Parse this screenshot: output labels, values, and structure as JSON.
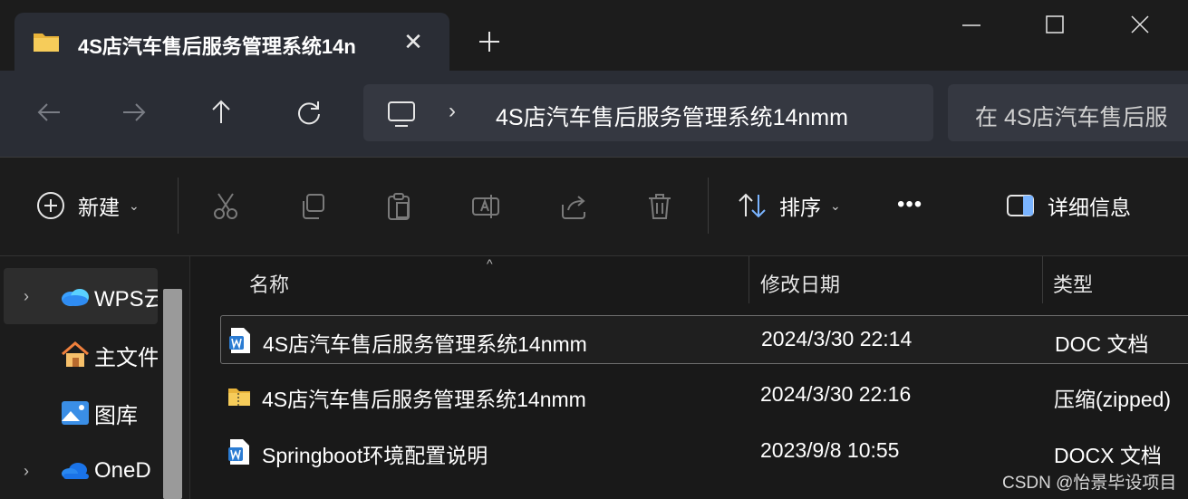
{
  "tab": {
    "title": "4S店汽车售后服务管理系统14n",
    "folder_icon": "folder-icon",
    "close_icon": "close-icon"
  },
  "new_tab_icon": "plus-icon",
  "window_controls": [
    "minimize-icon",
    "maximize-icon",
    "close-icon"
  ],
  "nav": {
    "icons": [
      "arrow-left-icon",
      "arrow-right-icon",
      "arrow-up-icon",
      "refresh-icon"
    ]
  },
  "address": {
    "root_icon": "monitor-icon",
    "separator": "›",
    "crumb": "4S店汽车售后服务管理系统14nmm"
  },
  "search": {
    "placeholder": "在 4S店汽车售后服"
  },
  "commands": {
    "new_label": "新建",
    "sort_label": "排序",
    "more_label": "•••",
    "details_label": "详细信息",
    "icons": [
      "cut-icon",
      "copy-icon",
      "paste-icon",
      "rename-icon",
      "share-icon",
      "delete-icon"
    ]
  },
  "sidebar": {
    "items": [
      {
        "label": "WPS云",
        "icon": "cloud-icon",
        "has_chevron": true
      },
      {
        "label": "主文件",
        "icon": "home-icon",
        "has_chevron": false
      },
      {
        "label": "图库",
        "icon": "gallery-icon",
        "has_chevron": false
      },
      {
        "label": "OneD",
        "icon": "onedrive-icon",
        "has_chevron": true
      }
    ]
  },
  "columns": {
    "name": "名称",
    "modified": "修改日期",
    "type": "类型"
  },
  "files": [
    {
      "name": "4S店汽车售后服务管理系统14nmm",
      "modified": "2024/3/30 22:14",
      "type": "DOC 文档",
      "icon": "word-doc-icon"
    },
    {
      "name": "4S店汽车售后服务管理系统14nmm",
      "modified": "2024/3/30 22:16",
      "type": "压缩(zipped)",
      "icon": "zip-folder-icon"
    },
    {
      "name": "Springboot环境配置说明",
      "modified": "2023/9/8 10:55",
      "type": "DOCX 文档",
      "icon": "word-doc-icon"
    }
  ],
  "watermark": "CSDN @怡景毕设项目",
  "colors": {
    "accent": "#2b7cd3",
    "folder": "#f3c453",
    "background": "#191919",
    "tab": "#2a2d35"
  }
}
